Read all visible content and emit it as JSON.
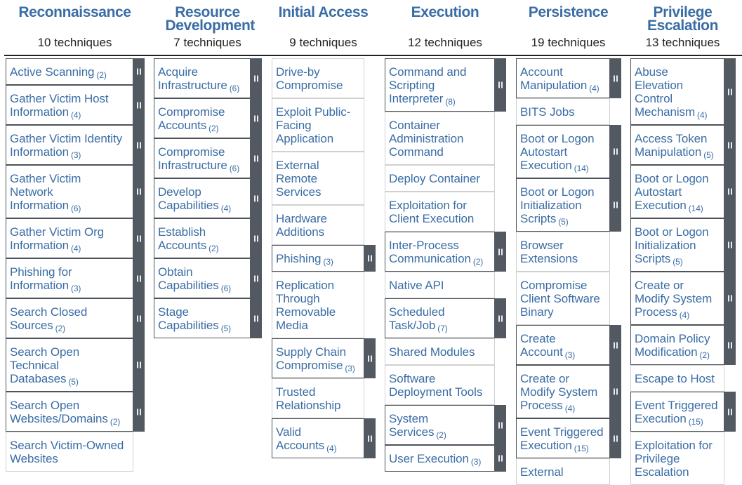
{
  "accent_color": "#3a6da5",
  "handle_color": "#525960",
  "tactics": [
    {
      "name": "Reconnaissance",
      "count_label": "10 techniques",
      "techniques": [
        {
          "name": "Active Scanning",
          "sub": "(2)"
        },
        {
          "name": "Gather Victim Host Information",
          "sub": "(4)"
        },
        {
          "name": "Gather Victim Identity Information",
          "sub": "(3)"
        },
        {
          "name": "Gather Victim Network Information",
          "sub": "(6)"
        },
        {
          "name": "Gather Victim Org Information",
          "sub": "(4)"
        },
        {
          "name": "Phishing for Information",
          "sub": "(3)"
        },
        {
          "name": "Search Closed Sources",
          "sub": "(2)"
        },
        {
          "name": "Search Open Technical Databases",
          "sub": "(5)"
        },
        {
          "name": "Search Open Websites/Domains",
          "sub": "(2)"
        },
        {
          "name": "Search Victim-Owned Websites",
          "sub": null
        }
      ]
    },
    {
      "name": "Resource Development",
      "count_label": "7 techniques",
      "techniques": [
        {
          "name": "Acquire Infrastructure",
          "sub": "(6)"
        },
        {
          "name": "Compromise Accounts",
          "sub": "(2)"
        },
        {
          "name": "Compromise Infrastructure",
          "sub": "(6)"
        },
        {
          "name": "Develop Capabilities",
          "sub": "(4)"
        },
        {
          "name": "Establish Accounts",
          "sub": "(2)"
        },
        {
          "name": "Obtain Capabilities",
          "sub": "(6)"
        },
        {
          "name": "Stage Capabilities",
          "sub": "(5)"
        }
      ]
    },
    {
      "name": "Initial Access",
      "count_label": "9 techniques",
      "techniques": [
        {
          "name": "Drive-by Compromise",
          "sub": null
        },
        {
          "name": "Exploit Public-Facing Application",
          "sub": null
        },
        {
          "name": "External Remote Services",
          "sub": null
        },
        {
          "name": "Hardware Additions",
          "sub": null
        },
        {
          "name": "Phishing",
          "sub": "(3)"
        },
        {
          "name": "Replication Through Removable Media",
          "sub": null
        },
        {
          "name": "Supply Chain Compromise",
          "sub": "(3)"
        },
        {
          "name": "Trusted Relationship",
          "sub": null
        },
        {
          "name": "Valid Accounts",
          "sub": "(4)"
        }
      ]
    },
    {
      "name": "Execution",
      "count_label": "12 techniques",
      "techniques": [
        {
          "name": "Command and Scripting Interpreter",
          "sub": "(8)"
        },
        {
          "name": "Container Administration Command",
          "sub": null
        },
        {
          "name": "Deploy Container",
          "sub": null
        },
        {
          "name": "Exploitation for Client Execution",
          "sub": null
        },
        {
          "name": "Inter-Process Communication",
          "sub": "(2)"
        },
        {
          "name": "Native API",
          "sub": null
        },
        {
          "name": "Scheduled Task/Job",
          "sub": "(7)"
        },
        {
          "name": "Shared Modules",
          "sub": null
        },
        {
          "name": "Software Deployment Tools",
          "sub": null
        },
        {
          "name": "System Services",
          "sub": "(2)"
        },
        {
          "name": "User Execution",
          "sub": "(3)"
        }
      ]
    },
    {
      "name": "Persistence",
      "count_label": "19 techniques",
      "techniques": [
        {
          "name": "Account Manipulation",
          "sub": "(4)"
        },
        {
          "name": "BITS Jobs",
          "sub": null
        },
        {
          "name": "Boot or Logon Autostart Execution",
          "sub": "(14)"
        },
        {
          "name": "Boot or Logon Initialization Scripts",
          "sub": "(5)"
        },
        {
          "name": "Browser Extensions",
          "sub": null
        },
        {
          "name": "Compromise Client Software Binary",
          "sub": null
        },
        {
          "name": "Create Account",
          "sub": "(3)"
        },
        {
          "name": "Create or Modify System Process",
          "sub": "(4)"
        },
        {
          "name": "Event Triggered Execution",
          "sub": "(15)"
        },
        {
          "name": "External",
          "sub": null
        }
      ]
    },
    {
      "name": "Privilege Escalation",
      "count_label": "13 techniques",
      "techniques": [
        {
          "name": "Abuse Elevation Control Mechanism",
          "sub": "(4)"
        },
        {
          "name": "Access Token Manipulation",
          "sub": "(5)"
        },
        {
          "name": "Boot or Logon Autostart Execution",
          "sub": "(14)"
        },
        {
          "name": "Boot or Logon Initialization Scripts",
          "sub": "(5)"
        },
        {
          "name": "Create or Modify System Process",
          "sub": "(4)"
        },
        {
          "name": "Domain Policy Modification",
          "sub": "(2)"
        },
        {
          "name": "Escape to Host",
          "sub": null
        },
        {
          "name": "Event Triggered Execution",
          "sub": "(15)"
        },
        {
          "name": "Exploitation for Privilege Escalation",
          "sub": null
        }
      ]
    }
  ]
}
